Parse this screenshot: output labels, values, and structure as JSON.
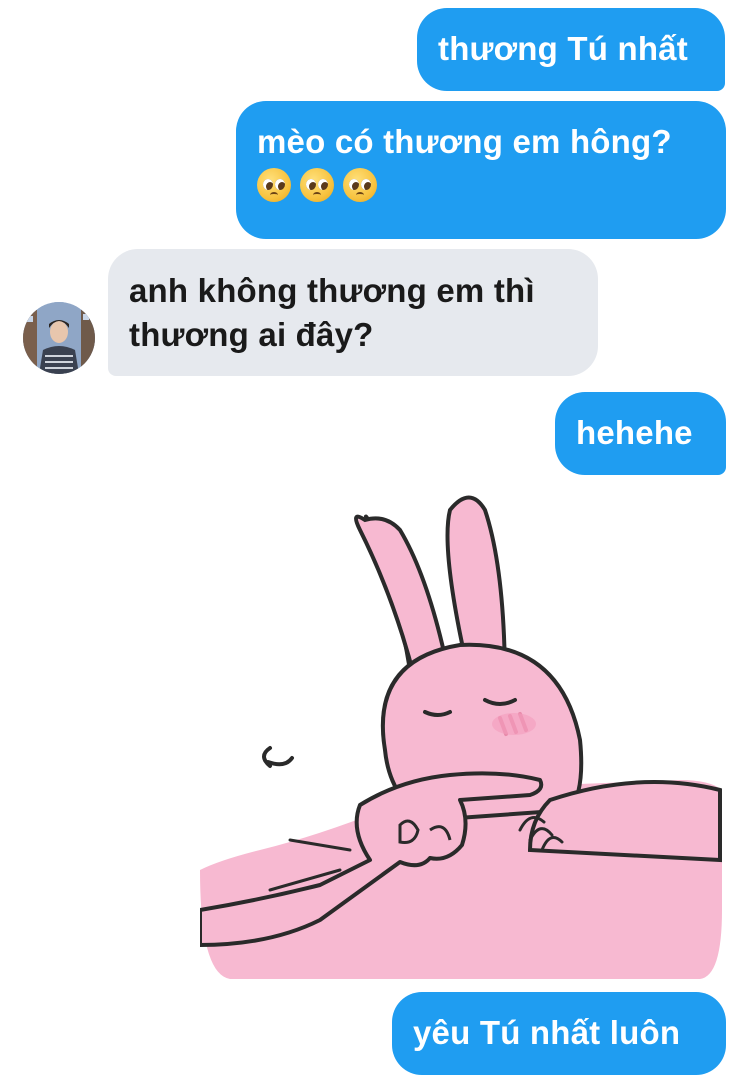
{
  "conversation": {
    "messages": [
      {
        "direction": "outgoing",
        "text": "thương Tú nhất"
      },
      {
        "direction": "outgoing",
        "text": "mèo có thương em hông?",
        "emojis": [
          "pleading-face-emoji",
          "pleading-face-emoji",
          "pleading-face-emoji"
        ]
      },
      {
        "direction": "incoming",
        "lines": [
          "anh không thương em thì",
          "thương ai đây?"
        ]
      },
      {
        "direction": "outgoing",
        "text": "hehehe"
      },
      {
        "direction": "outgoing",
        "type": "sticker",
        "sticker": "pink-rabbit-shy-sticker"
      },
      {
        "direction": "outgoing",
        "text": "yêu Tú nhất luôn"
      }
    ]
  },
  "colors": {
    "outgoing_bubble": "#1f9df1",
    "incoming_bubble": "#e6e9ee",
    "sticker_pink": "#f7b9d1"
  },
  "icons": {
    "avatar": "contact-avatar-photo"
  }
}
